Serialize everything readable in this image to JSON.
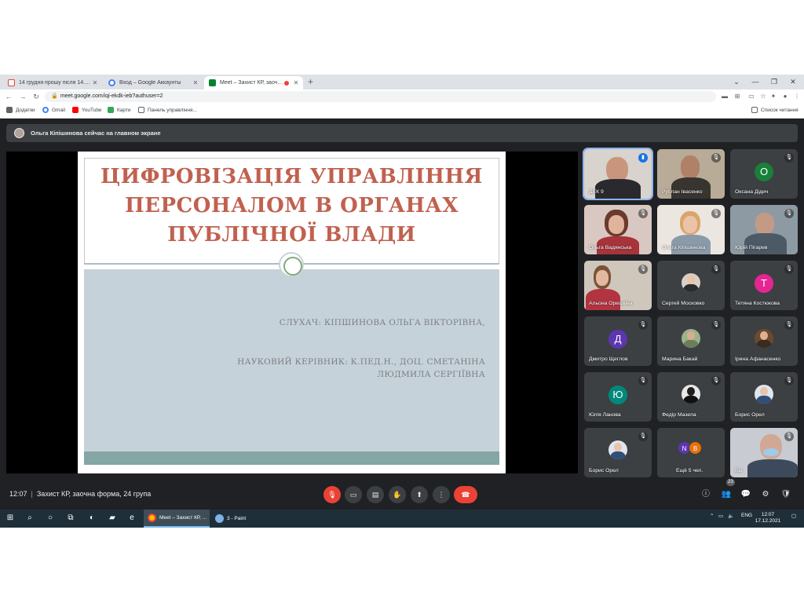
{
  "browser": {
    "tabs": [
      {
        "title": "14 грудня прошу після 14.00 пі",
        "icon": "gmail-icon"
      },
      {
        "title": "Вход – Google Аккаунты",
        "icon": "google-icon"
      },
      {
        "title": "Meet – Захист КР, заочна ф",
        "icon": "meet-icon",
        "active": true
      }
    ],
    "url": "meet.google.com/iqi-ekdk-ieb?authuser=2",
    "bookmarks": [
      {
        "label": "Додатки",
        "icon": "apps-grid-icon"
      },
      {
        "label": "Gmail",
        "icon": "google-icon"
      },
      {
        "label": "YouTube",
        "icon": "youtube-icon"
      },
      {
        "label": "Карти",
        "icon": "maps-icon"
      },
      {
        "label": "Панель управління...",
        "icon": "doc-icon"
      }
    ],
    "reading_list": "Список читання"
  },
  "meet": {
    "presenter_banner": "Ольга Кіпішинова сейчас на главном экране",
    "slide": {
      "title_line1": "ЦИФРОВІЗАЦІЯ УПРАВЛІННЯ",
      "title_line2": "ПЕРСОНАЛОМ В ОРГАНАХ",
      "title_line3": "ПУБЛІЧНОЇ ВЛАДИ",
      "student": "СЛУХАЧ:  КІПШИНОВА ОЛЬГА ВІКТОРІВНА,",
      "advisor_line1": "НАУКОВИЙ КЕРІВНИК: К.ПЕД.Н., ДОЦ. СМЕТАНІНА",
      "advisor_line2": "ЛЮДМИЛА СЕРГІЇВНА"
    },
    "participants": [
      {
        "name": "ДЕК 9",
        "type": "video",
        "speaking": true
      },
      {
        "name": "Руслан Івасенко",
        "type": "video"
      },
      {
        "name": "Оксана Дідич",
        "type": "letter",
        "letter": "О",
        "color": "#188038"
      },
      {
        "name": "Ольга Вадянська",
        "type": "video"
      },
      {
        "name": "Ольга Кіпішинова",
        "type": "video"
      },
      {
        "name": "Юрій Пігарев",
        "type": "video"
      },
      {
        "name": "Альона Орешкіна",
        "type": "video"
      },
      {
        "name": "Сергей Московко",
        "type": "photo"
      },
      {
        "name": "Тетяна Костюкова",
        "type": "letter",
        "letter": "Т",
        "color": "#e52592"
      },
      {
        "name": "Дмитро Щеглов",
        "type": "letter",
        "letter": "Д",
        "color": "#5e35b1"
      },
      {
        "name": "Марина Бакай",
        "type": "photo"
      },
      {
        "name": "Ірина Афанасенко",
        "type": "photo"
      },
      {
        "name": "Юлія Ланова",
        "type": "letter",
        "letter": "Ю",
        "color": "#00897b"
      },
      {
        "name": "Федір Мазепа",
        "type": "photo"
      },
      {
        "name": "Борис Орел",
        "type": "photo"
      },
      {
        "name": "Борис Орел",
        "type": "photo"
      },
      {
        "name": "Ещё 5 чел.",
        "type": "more",
        "letters": [
          "N",
          "B"
        ]
      },
      {
        "name": "Вы",
        "type": "video"
      }
    ],
    "meeting_time": "12:07",
    "meeting_title": "Захист КР, заочна форма, 24 група",
    "participant_count": "23",
    "colors": {
      "background": "#202124",
      "tile": "#3c4043",
      "danger": "#ea4335",
      "accent": "#8ab4f8"
    }
  },
  "taskbar": {
    "apps": [
      {
        "label": "Meet – Захист КР, ...",
        "active": true
      },
      {
        "label": "3 - Paint",
        "active": false
      }
    ],
    "language": "ENG",
    "time": "12:07",
    "date": "17.12.2021"
  }
}
